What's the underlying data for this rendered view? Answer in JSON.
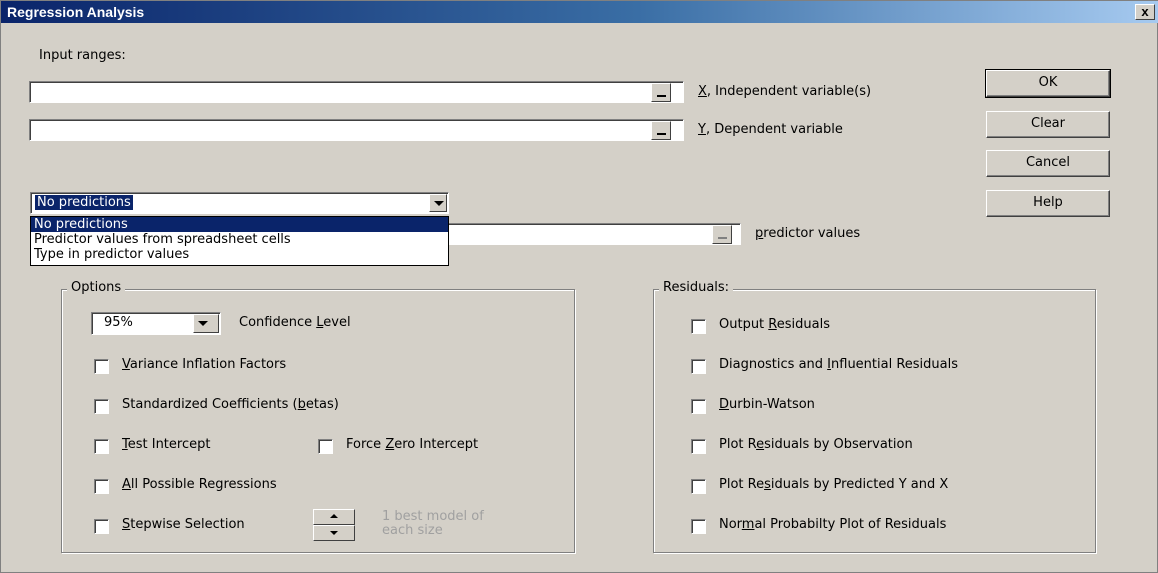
{
  "window": {
    "title": "Regression Analysis",
    "close_label": "x"
  },
  "input_ranges_label": "Input ranges:",
  "x_field": {
    "value": "",
    "label_key": "X",
    "label_rest": ", Independent variable(s)"
  },
  "y_field": {
    "value": "",
    "label_key": "Y",
    "label_rest": ", Dependent variable"
  },
  "buttons": {
    "ok": "OK",
    "clear": "Clear",
    "cancel": "Cancel",
    "help": "Help"
  },
  "predictions": {
    "selected": "No predictions",
    "options": [
      "No predictions",
      "Predictor values from spreadsheet cells",
      "Type in predictor values"
    ],
    "field_value": "",
    "label_key": "p",
    "label_rest": "redictor values"
  },
  "options_group": {
    "title": "Options",
    "confidence_value": "95%",
    "confidence_pre": "Confidence ",
    "confidence_key": "L",
    "confidence_post": "evel",
    "vif": {
      "key": "V",
      "rest": "ariance Inflation Factors"
    },
    "std_coef": {
      "pre": "Standardized Coefficients (",
      "key": "b",
      "post": "etas)"
    },
    "test_intercept": {
      "key": "T",
      "rest": "est Intercept"
    },
    "force_zero": {
      "pre": "Force ",
      "key": "Z",
      "post": "ero Intercept"
    },
    "all_possible": {
      "key": "A",
      "rest": "ll Possible Regressions"
    },
    "stepwise": {
      "key": "S",
      "rest": "tepwise Selection"
    },
    "best_model_line1": "1 best model of",
    "best_model_line2": "each size"
  },
  "residuals_group": {
    "title": "Residuals:",
    "output": {
      "pre": "Output ",
      "key": "R",
      "post": "esiduals"
    },
    "diagnostics": {
      "pre": "Diagnostics and ",
      "key": "I",
      "post": "nfluential Residuals"
    },
    "durbin": {
      "key": "D",
      "rest": "urbin-Watson"
    },
    "plot_obs": {
      "pre": "Plot R",
      "key": "e",
      "post": "siduals by Observation"
    },
    "plot_pred": {
      "pre": "Plot Re",
      "key": "s",
      "post": "iduals by Predicted Y and X"
    },
    "normal": {
      "pre": "Nor",
      "key": "m",
      "post": "al Probabilty Plot of Residuals"
    }
  }
}
